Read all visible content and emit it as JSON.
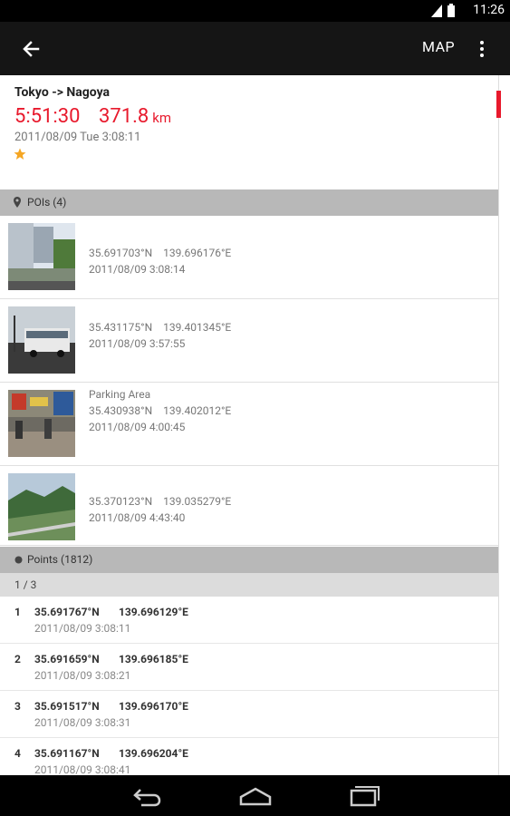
{
  "status": {
    "time": "11:26"
  },
  "actionbar": {
    "map_label": "MAP"
  },
  "summary": {
    "title": "Tokyo -> Nagoya",
    "duration": "5:51:30",
    "distance": "371.8",
    "distance_unit": "km",
    "date": "2011/08/09 Tue  3:08:11",
    "star_color": "#f5a623"
  },
  "pois_header": "POIs (4)",
  "pois": [
    {
      "label": "",
      "lat": "35.691703°N",
      "lon": "139.696176°E",
      "time": "2011/08/09  3:08:14"
    },
    {
      "label": "",
      "lat": "35.431175°N",
      "lon": "139.401345°E",
      "time": "2011/08/09  3:57:55"
    },
    {
      "label": "Parking Area",
      "lat": "35.430938°N",
      "lon": "139.402012°E",
      "time": "2011/08/09  4:00:45"
    },
    {
      "label": "",
      "lat": "35.370123°N",
      "lon": "139.035279°E",
      "time": "2011/08/09  4:43:40"
    }
  ],
  "points_header": "Points (1812)",
  "page": "1 / 3",
  "points": [
    {
      "index": "1",
      "lat": "35.691767°N",
      "lon": "139.696129°E",
      "time": "2011/08/09  3:08:11"
    },
    {
      "index": "2",
      "lat": "35.691659°N",
      "lon": "139.696185°E",
      "time": "2011/08/09  3:08:21"
    },
    {
      "index": "3",
      "lat": "35.691517°N",
      "lon": "139.696170°E",
      "time": "2011/08/09  3:08:31"
    },
    {
      "index": "4",
      "lat": "35.691167°N",
      "lon": "139.696204°E",
      "time": "2011/08/09  3:08:41"
    }
  ],
  "colors": {
    "accent": "#e8192c",
    "section_bg": "#b8b8b8",
    "actionbar": "#151515"
  }
}
